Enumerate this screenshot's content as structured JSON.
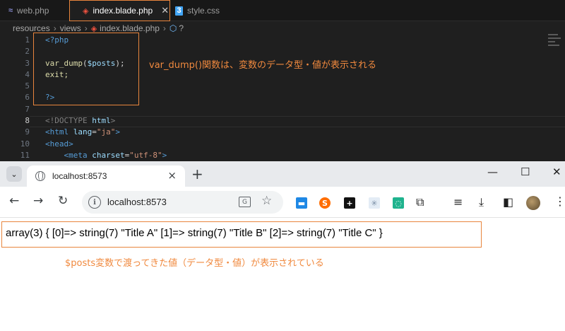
{
  "editor": {
    "tabs": [
      {
        "label": "web.php",
        "icon": "php-icon"
      },
      {
        "label": "index.blade.php",
        "icon": "laravel-icon"
      },
      {
        "label": "style.css",
        "icon": "css-icon"
      }
    ],
    "close_glyph": "✕",
    "breadcrumb": [
      "resources",
      "views",
      "index.blade.php"
    ],
    "breadcrumb_tail": "?",
    "line_numbers": [
      "1",
      "2",
      "3",
      "4",
      "5",
      "6",
      "7",
      "8",
      "9",
      "10",
      "11"
    ],
    "code": {
      "l1": "<?php",
      "l3_fn": "var_dump",
      "l3_var": "$posts",
      "l3_end": ");",
      "l4": "exit;",
      "l6": "?>",
      "l8_tag": "<!DOCTYPE",
      "l8_name": "html",
      "l8_end": ">",
      "l9_tag": "<html",
      "l9_attr": "lang",
      "l9_val": "\"ja\"",
      "l10_tag": "<head>",
      "l11_tag": "<meta",
      "l11_attr": "charset",
      "l11_val": "\"utf-8\""
    },
    "annotation": "var_dump()関数は、変数のデータ型・値が表示される",
    "accent": "#e8853d"
  },
  "browser": {
    "tab_title": "localhost:8573",
    "new_tab_glyph": "+",
    "window_controls": [
      "—",
      "☐",
      "✕"
    ],
    "url": "localhost:8573",
    "nav": [
      "←",
      "→",
      "↻"
    ],
    "output_text": "array(3) { [0]=> string(7) \"Title A\" [1]=> string(7) \"Title B\" [2]=> string(7) \"Title C\" }",
    "annotation": "$posts変数で渡ってきた値（データ型・値）が表示されている"
  }
}
